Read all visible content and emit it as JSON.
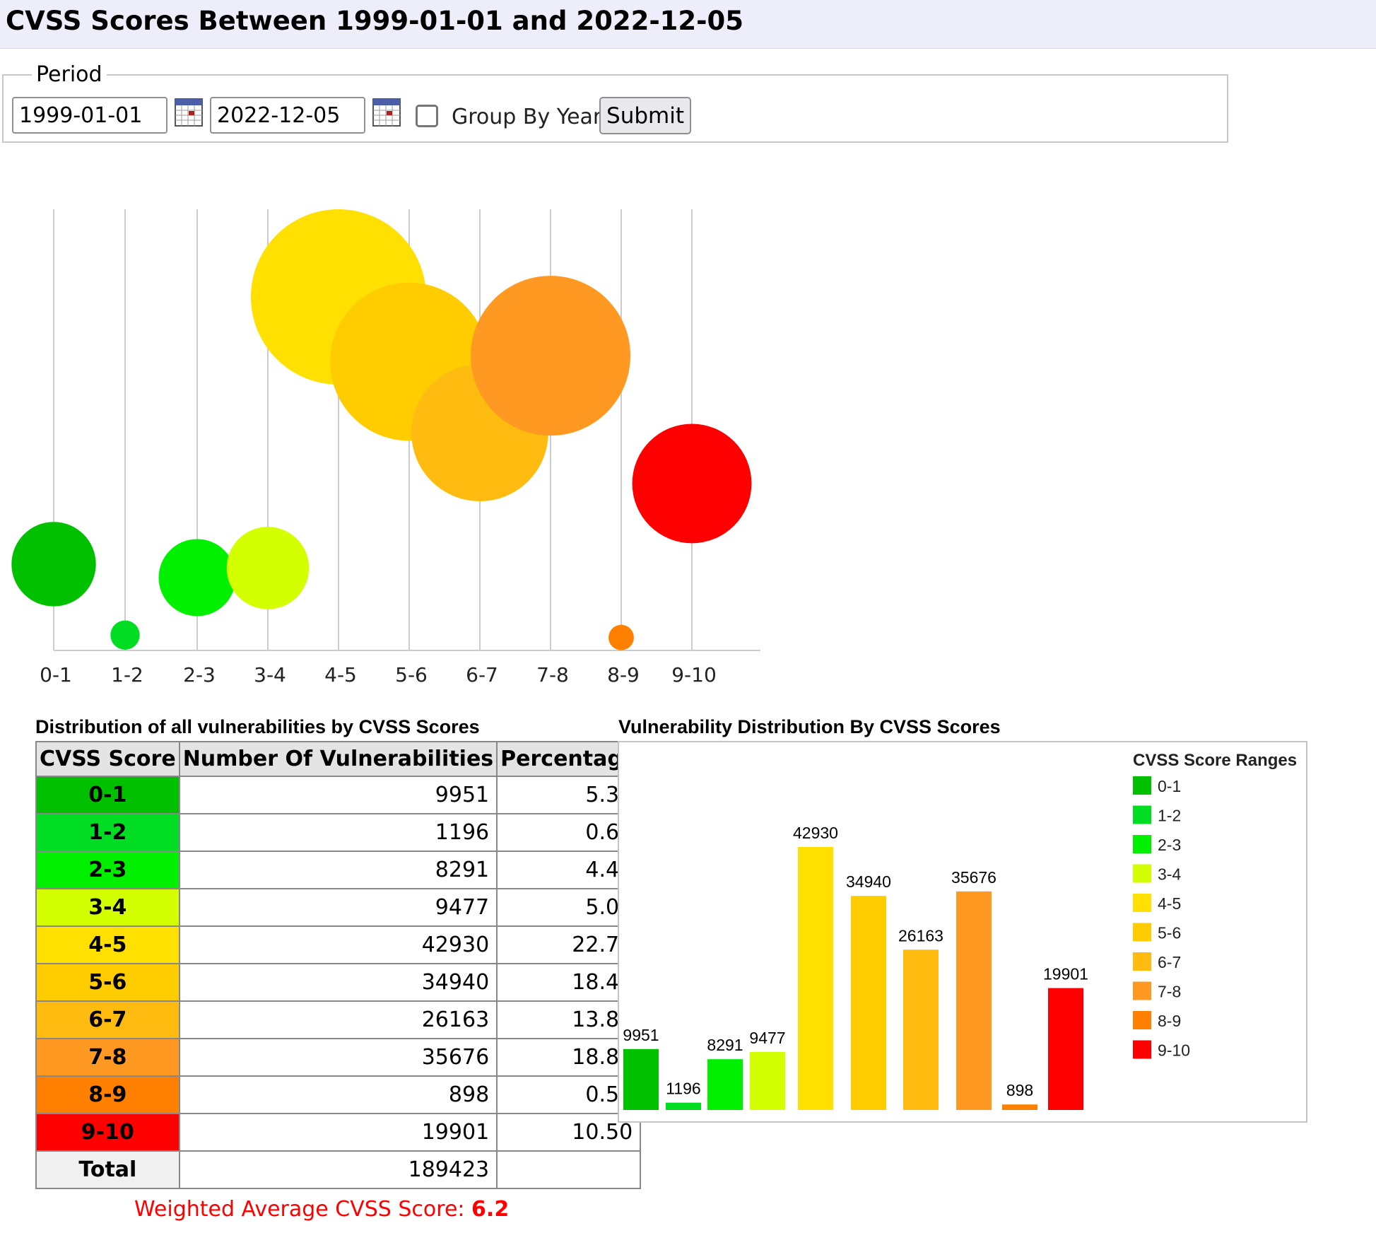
{
  "header": {
    "title": "CVSS Scores Between 1999-01-01 and 2022-12-05"
  },
  "form": {
    "legend": "Period",
    "start_date": "1999-01-01",
    "end_date": "2022-12-05",
    "group_by_year_label": "Group By Year",
    "group_by_year_checked": false,
    "submit_label": "Submit"
  },
  "colors": {
    "header_bg": "#eeeefb",
    "0-1": "#00c000",
    "1-2": "#00dd22",
    "2-3": "#00f000",
    "3-4": "#d4ff00",
    "4-5": "#ffe000",
    "5-6": "#ffcc00",
    "6-7": "#ffbb10",
    "7-8": "#ff9922",
    "8-9": "#ff8000",
    "9-10": "#ff0000"
  },
  "table": {
    "title": "Distribution of all vulnerabilities by CVSS Scores",
    "headers": [
      "CVSS Score",
      "Number Of Vulnerabilities",
      "Percentage"
    ],
    "rows": [
      {
        "score": "0-1",
        "count": "9951",
        "pct": "5.30"
      },
      {
        "score": "1-2",
        "count": "1196",
        "pct": "0.60"
      },
      {
        "score": "2-3",
        "count": "8291",
        "pct": "4.40"
      },
      {
        "score": "3-4",
        "count": "9477",
        "pct": "5.00"
      },
      {
        "score": "4-5",
        "count": "42930",
        "pct": "22.70"
      },
      {
        "score": "5-6",
        "count": "34940",
        "pct": "18.40"
      },
      {
        "score": "6-7",
        "count": "26163",
        "pct": "13.80"
      },
      {
        "score": "7-8",
        "count": "35676",
        "pct": "18.80"
      },
      {
        "score": "8-9",
        "count": "898",
        "pct": "0.50"
      },
      {
        "score": "9-10",
        "count": "19901",
        "pct": "10.50"
      }
    ],
    "total_label": "Total",
    "total_count": "189423",
    "total_pct": "",
    "weighted_label": "Weighted Average CVSS Score: ",
    "weighted_value": "6.2"
  },
  "chart_data": [
    {
      "type": "scatter",
      "title": "",
      "categories": [
        "0-1",
        "1-2",
        "2-3",
        "3-4",
        "4-5",
        "5-6",
        "6-7",
        "7-8",
        "8-9",
        "9-10"
      ],
      "values": [
        9951,
        1196,
        8291,
        9477,
        42930,
        34940,
        26163,
        35676,
        898,
        19901
      ],
      "encoding": "bubble",
      "grid": true
    },
    {
      "type": "bar",
      "title": "Vulnerability Distribution By CVSS Scores",
      "categories": [
        "0-1",
        "1-2",
        "2-3",
        "3-4",
        "4-5",
        "5-6",
        "6-7",
        "7-8",
        "8-9",
        "9-10"
      ],
      "values": [
        9951,
        1196,
        8291,
        9477,
        42930,
        34940,
        26163,
        35676,
        898,
        19901
      ],
      "legend_title": "CVSS Score Ranges",
      "legend_position": "right",
      "xlabel": "",
      "ylabel": ""
    }
  ]
}
